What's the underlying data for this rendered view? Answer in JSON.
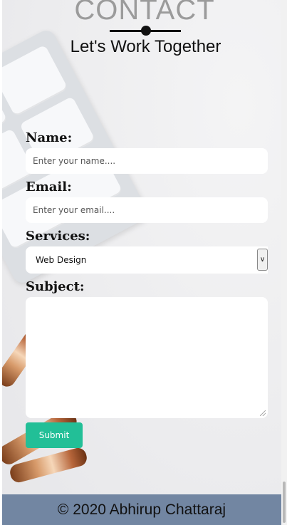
{
  "header": {
    "title": "CONTACT",
    "subtitle": "Let's Work Together"
  },
  "form": {
    "name_label": "Name:",
    "name_placeholder": "Enter your name....",
    "email_label": "Email:",
    "email_placeholder": "Enter your email....",
    "services_label": "Services:",
    "services_selected": "Web Design",
    "subject_label": "Subject:",
    "subject_value": "",
    "submit_label": "Submit"
  },
  "footer": {
    "text": "© 2020 Abhirup Chattaraj"
  },
  "colors": {
    "accent": "#22bf97",
    "footer_bg": "#7286a2",
    "heading": "#9b9b9b"
  }
}
